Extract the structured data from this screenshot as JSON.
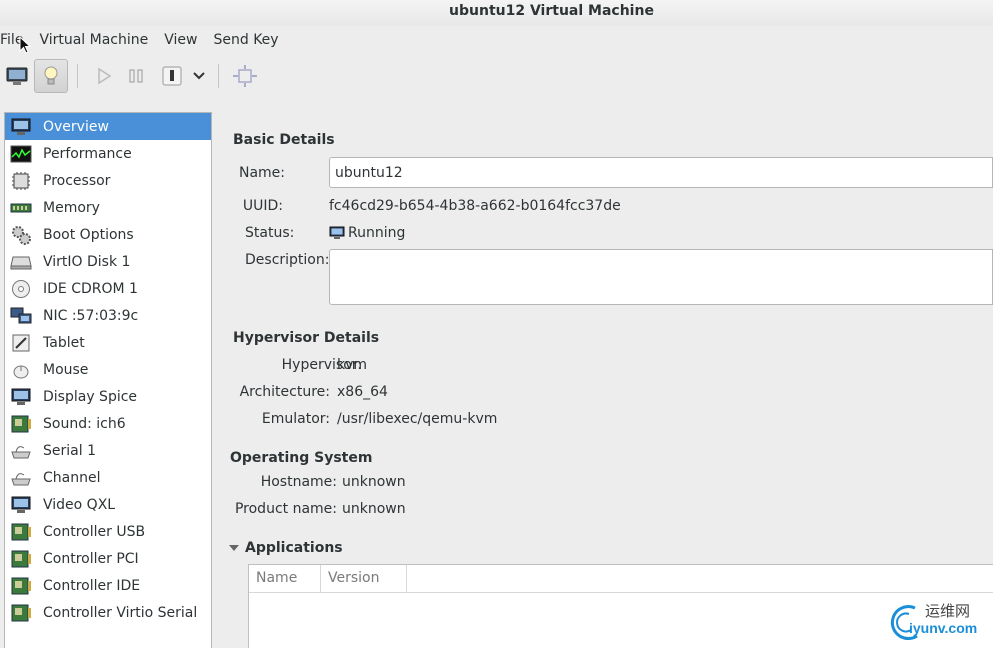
{
  "window": {
    "title": "ubuntu12 Virtual Machine"
  },
  "menubar": {
    "items": [
      "File",
      "Virtual Machine",
      "View",
      "Send Key"
    ]
  },
  "toolbar": {
    "icons": [
      "console-icon",
      "lightbulb-icon",
      "play-icon",
      "pause-icon",
      "power-icon",
      "chevron-down-icon",
      "fullscreen-icon"
    ]
  },
  "sidebar": {
    "items": [
      {
        "label": "Overview",
        "icon": "monitor-icon",
        "selected": true
      },
      {
        "label": "Performance",
        "icon": "chart-icon"
      },
      {
        "label": "Processor",
        "icon": "cpu-icon"
      },
      {
        "label": "Memory",
        "icon": "memory-icon"
      },
      {
        "label": "Boot Options",
        "icon": "gears-icon"
      },
      {
        "label": "VirtIO Disk 1",
        "icon": "disk-icon"
      },
      {
        "label": "IDE CDROM 1",
        "icon": "cdrom-icon"
      },
      {
        "label": "NIC :57:03:9c",
        "icon": "network-icon"
      },
      {
        "label": "Tablet",
        "icon": "tablet-icon"
      },
      {
        "label": "Mouse",
        "icon": "mouse-icon"
      },
      {
        "label": "Display Spice",
        "icon": "display-icon"
      },
      {
        "label": "Sound: ich6",
        "icon": "sound-card-icon"
      },
      {
        "label": "Serial 1",
        "icon": "serial-icon"
      },
      {
        "label": "Channel",
        "icon": "channel-icon"
      },
      {
        "label": "Video QXL",
        "icon": "video-icon"
      },
      {
        "label": "Controller USB",
        "icon": "controller-icon"
      },
      {
        "label": "Controller PCI",
        "icon": "controller-icon"
      },
      {
        "label": "Controller IDE",
        "icon": "controller-icon"
      },
      {
        "label": "Controller Virtio Serial",
        "icon": "controller-icon"
      }
    ]
  },
  "basic": {
    "title": "Basic Details",
    "name_label": "Name:",
    "name_value": "ubuntu12",
    "uuid_label": "UUID:",
    "uuid_value": "fc46cd29-b654-4b38-a662-b0164fcc37de",
    "status_label": "Status:",
    "status_value": "Running",
    "description_label": "Description:",
    "description_value": ""
  },
  "hypervisor": {
    "title": "Hypervisor Details",
    "hypervisor_label": "Hypervisor:",
    "hypervisor_value": "kvm",
    "arch_label": "Architecture:",
    "arch_value": "x86_64",
    "emulator_label": "Emulator:",
    "emulator_value": "/usr/libexec/qemu-kvm"
  },
  "os": {
    "title": "Operating System",
    "hostname_label": "Hostname:",
    "hostname_value": "unknown",
    "product_label": "Product name:",
    "product_value": "unknown"
  },
  "applications": {
    "title": "Applications",
    "columns": [
      "Name",
      "Version"
    ]
  },
  "watermark": {
    "line1": "运维网",
    "line2": "iyunv.com"
  },
  "colors": {
    "selection": "#4a90d9",
    "watermark": "#1a8fd8"
  }
}
